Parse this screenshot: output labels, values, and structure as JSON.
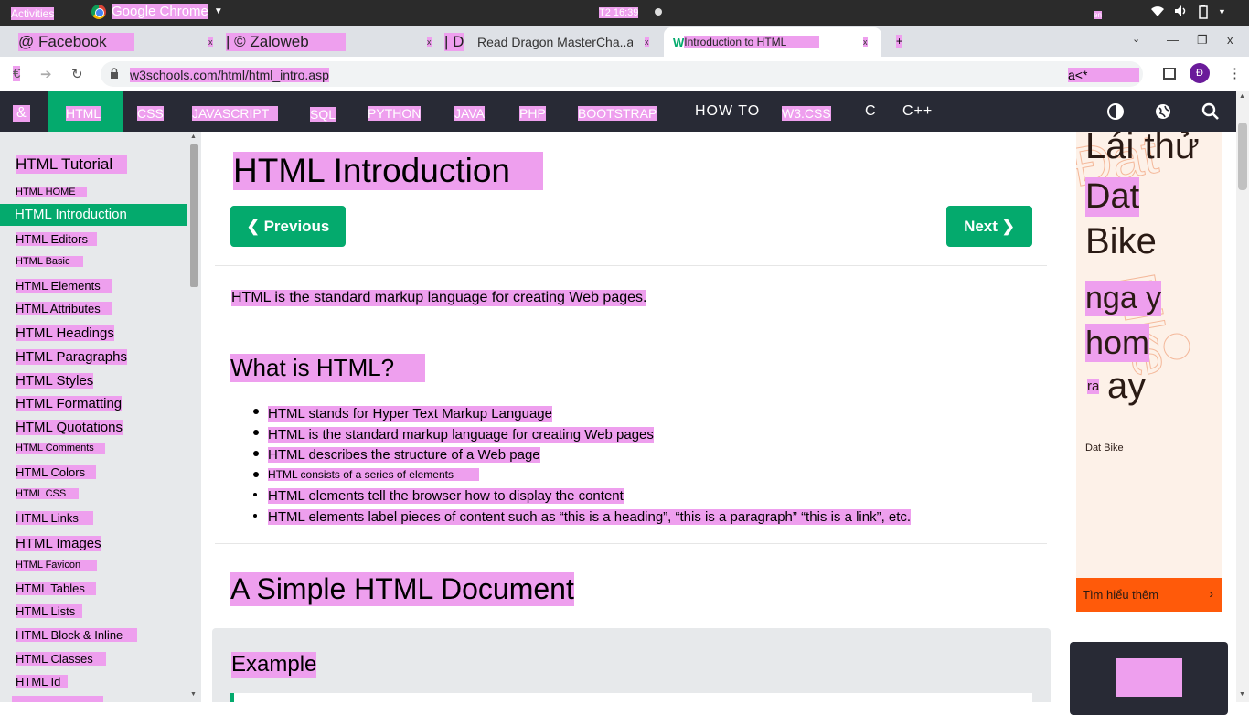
{
  "system_bar": {
    "activities": "Activities",
    "app_name": "Google Chrome",
    "clock": "T2 16:39",
    "lang": "en"
  },
  "tabs": [
    {
      "title": "@ Facebook"
    },
    {
      "title": "| © Zaloweb"
    },
    {
      "title": "| D"
    },
    {
      "title": "Read Dragon MasterCha..ap"
    },
    {
      "title": "Introduction to HTML"
    }
  ],
  "tab_close": "x",
  "new_tab": "+",
  "window_controls": {
    "minimize": "—",
    "restore": "❐",
    "close": "x"
  },
  "address": {
    "back": "€",
    "url": "w3schools.com/html/html_intro.asp",
    "extra": "a<*",
    "profile_initial": "Đ"
  },
  "w3nav": {
    "logo": "&",
    "items": [
      "HTML",
      "CSS",
      "JAVASCRIPT",
      "SQL",
      "PYTHON",
      "JAVA",
      "PHP",
      "BOOTSTRAP",
      "HOW TO",
      "W3.CSS",
      "C",
      "C++"
    ]
  },
  "sidebar": {
    "title": "HTML Tutorial",
    "items": [
      "HTML HOME",
      "HTML Introduction",
      "HTML Editors",
      "HTML Basic",
      "HTML Elements",
      "HTML Attributes",
      "HTML Headings",
      "HTML Paragraphs",
      "HTML Styles",
      "HTML Formatting",
      "HTML Quotations",
      "HTML Comments",
      "HTML Colors",
      "HTML CSS",
      "HTML Links",
      "HTML Images",
      "HTML Favicon",
      "HTML Tables",
      "HTML Lists",
      "HTML Block & Inline",
      "HTML Classes",
      "HTML Id"
    ]
  },
  "main": {
    "title": "HTML Introduction",
    "prev": "❮ Previous",
    "next": "Next ❯",
    "intro": "HTML is the standard markup language for creating Web pages.",
    "what_heading": "What is HTML?",
    "bullets": [
      "HTML stands for Hyper Text Markup Language",
      "HTML is the standard markup language for creating Web pages",
      "HTML describes the structure of a Web page",
      "HTML consists of a series of elements",
      "HTML elements tell the browser how to display the content",
      "HTML elements label pieces of content such as “this is a heading”, “this is a paragraph” “this is a link”, etc."
    ],
    "doc_heading": "A Simple HTML Document",
    "example_label": "Example"
  },
  "ad": {
    "lines": [
      "Lái thử",
      "Dat",
      "Bike",
      "nga y",
      "hom",
      "ay"
    ],
    "small": "ra",
    "brand": "Dat Bike",
    "cta": "Tìm hiểu thêm"
  }
}
